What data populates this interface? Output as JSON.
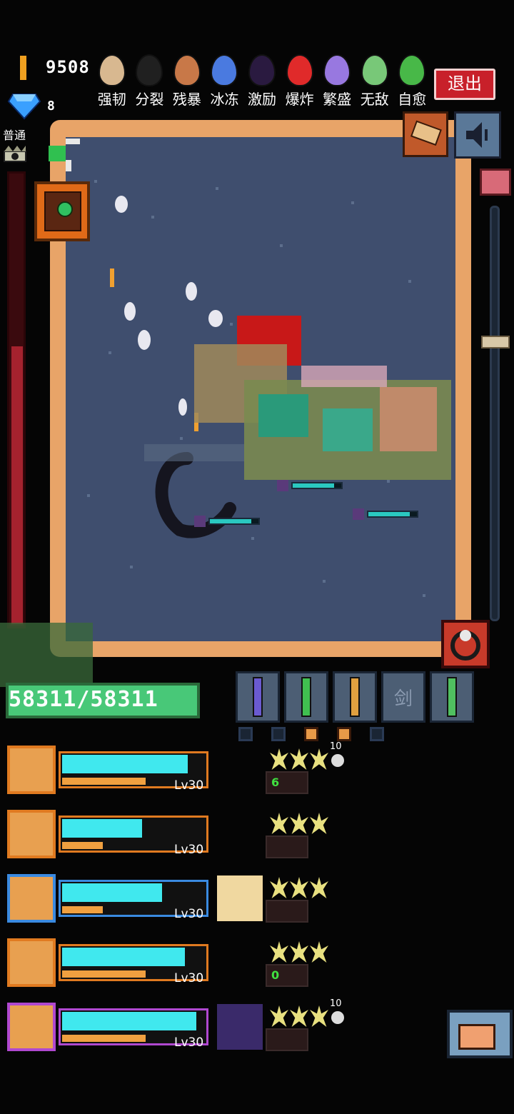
{
  "top_bar": {
    "gold": "9508",
    "gems": "8",
    "exit_label": "退出"
  },
  "eggs": [
    {
      "label": "强韧",
      "color": "#d8b890"
    },
    {
      "label": "分裂",
      "color": "#202020"
    },
    {
      "label": "残暴",
      "color": "#c87848"
    },
    {
      "label": "冰冻",
      "color": "#4a7ae0"
    },
    {
      "label": "激励",
      "color": "#2a1a40"
    },
    {
      "label": "爆炸",
      "color": "#e02a2a"
    },
    {
      "label": "繁盛",
      "color": "#9878e0"
    },
    {
      "label": "无敌",
      "color": "#78c878"
    },
    {
      "label": "自愈",
      "color": "#48b848"
    }
  ],
  "side": {
    "mode_label": "普通",
    "progress_fraction": 0.62
  },
  "player": {
    "hp_text": "58311/58311",
    "hp_fraction": 1.0
  },
  "weapon_slots": [
    {
      "name": "purple-sword",
      "label": ""
    },
    {
      "name": "green-sword",
      "label": ""
    },
    {
      "name": "hammer",
      "label": ""
    },
    {
      "name": "empty-sword",
      "label": "剑"
    },
    {
      "name": "green-axe",
      "label": ""
    }
  ],
  "party": [
    {
      "level": "Lv30",
      "hp_fraction": 0.88,
      "exp_fraction": 0.78,
      "frame_color": "#e07a20",
      "badge": "10",
      "extra": "6"
    },
    {
      "level": "Lv30",
      "hp_fraction": 0.56,
      "exp_fraction": 0.38,
      "frame_color": "#e07a20",
      "badge": "",
      "extra": ""
    },
    {
      "level": "Lv30",
      "hp_fraction": 0.7,
      "exp_fraction": 0.38,
      "frame_color": "#3a8ae0",
      "badge": "",
      "extra": ""
    },
    {
      "level": "Lv30",
      "hp_fraction": 0.86,
      "exp_fraction": 0.78,
      "frame_color": "#e07a20",
      "badge": "",
      "extra": "0"
    },
    {
      "level": "Lv30",
      "hp_fraction": 0.94,
      "exp_fraction": 0.78,
      "frame_color": "#b048d0",
      "badge": "10",
      "extra": ""
    }
  ]
}
